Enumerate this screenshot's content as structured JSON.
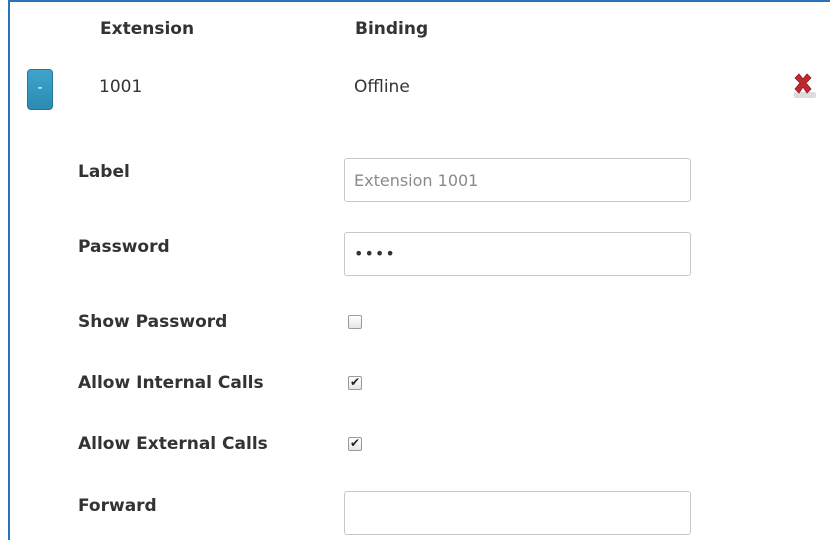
{
  "header": {
    "extension_col": "Extension",
    "binding_col": "Binding"
  },
  "row": {
    "collapse_label": "-",
    "extension": "1001",
    "binding": "Offline",
    "delete_icon": "red-x-icon"
  },
  "form": {
    "label": {
      "label": "Label",
      "placeholder": "Extension 1001",
      "value": ""
    },
    "password": {
      "label": "Password",
      "masked_value": "••••"
    },
    "show_password": {
      "label": "Show Password",
      "checked": false
    },
    "allow_internal": {
      "label": "Allow Internal Calls",
      "checked": true
    },
    "allow_external": {
      "label": "Allow External Calls",
      "checked": true
    },
    "forward": {
      "label": "Forward",
      "value": ""
    }
  },
  "colors": {
    "accent_border": "#2c72b8",
    "button": "#2b8bb3",
    "delete": "#c0282d"
  }
}
